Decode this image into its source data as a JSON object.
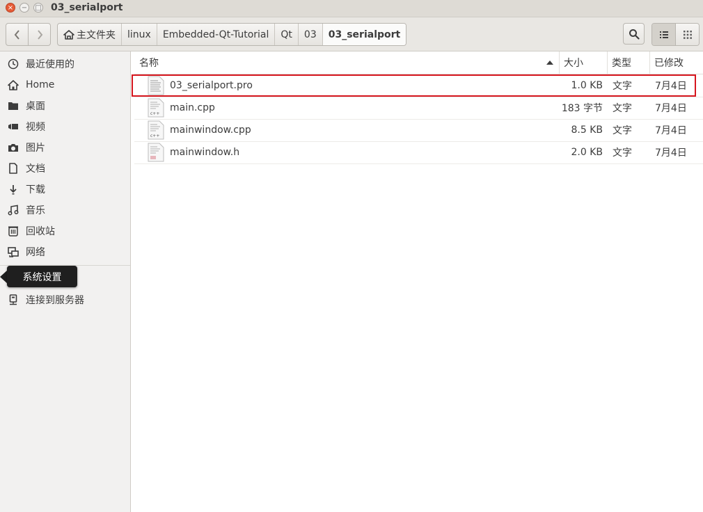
{
  "window": {
    "title": "03_serialport",
    "close_glyph": "×",
    "minimize_glyph": "−",
    "maximize_glyph": "□"
  },
  "toolbar": {
    "back_icon": "chevron-left-icon",
    "forward_icon": "chevron-right-icon",
    "breadcrumbs": [
      {
        "label": "主文件夹",
        "icon": "home-icon"
      },
      {
        "label": "linux"
      },
      {
        "label": "Embedded-Qt-Tutorial"
      },
      {
        "label": "Qt"
      },
      {
        "label": "03"
      },
      {
        "label": "03_serialport",
        "active": true
      }
    ],
    "search_icon": "search-icon",
    "list_view_icon": "list-view-icon",
    "grid_view_icon": "grid-view-icon"
  },
  "sidebar": {
    "items": [
      {
        "label": "最近使用的",
        "icon": "clock-icon"
      },
      {
        "label": "Home",
        "icon": "home-icon"
      },
      {
        "label": "桌面",
        "icon": "folder-icon"
      },
      {
        "label": "视频",
        "icon": "video-icon"
      },
      {
        "label": "图片",
        "icon": "camera-icon"
      },
      {
        "label": "文档",
        "icon": "document-icon"
      },
      {
        "label": "下载",
        "icon": "download-icon"
      },
      {
        "label": "音乐",
        "icon": "music-icon"
      },
      {
        "label": "回收站",
        "icon": "trash-icon"
      },
      {
        "label": "网络",
        "icon": "network-icon"
      },
      {
        "label": "连接到服务器",
        "icon": "server-icon"
      }
    ],
    "tooltip": "系统设置"
  },
  "file_list": {
    "columns": {
      "name": "名称",
      "size": "大小",
      "type": "类型",
      "modified": "已修改"
    },
    "rows": [
      {
        "name": "03_serialport.pro",
        "size": "1.0 KB",
        "type": "文字",
        "modified": "7月4日",
        "icon": "text-file-icon"
      },
      {
        "name": "main.cpp",
        "size": "183 字节",
        "type": "文字",
        "modified": "7月4日",
        "icon": "cpp-file-icon"
      },
      {
        "name": "mainwindow.cpp",
        "size": "8.5 KB",
        "type": "文字",
        "modified": "7月4日",
        "icon": "cpp-file-icon"
      },
      {
        "name": "mainwindow.h",
        "size": "2.0 KB",
        "type": "文字",
        "modified": "7月4日",
        "icon": "header-file-icon"
      }
    ]
  },
  "colors": {
    "highlight_border": "#d6161e",
    "close_button": "#e65a35"
  }
}
